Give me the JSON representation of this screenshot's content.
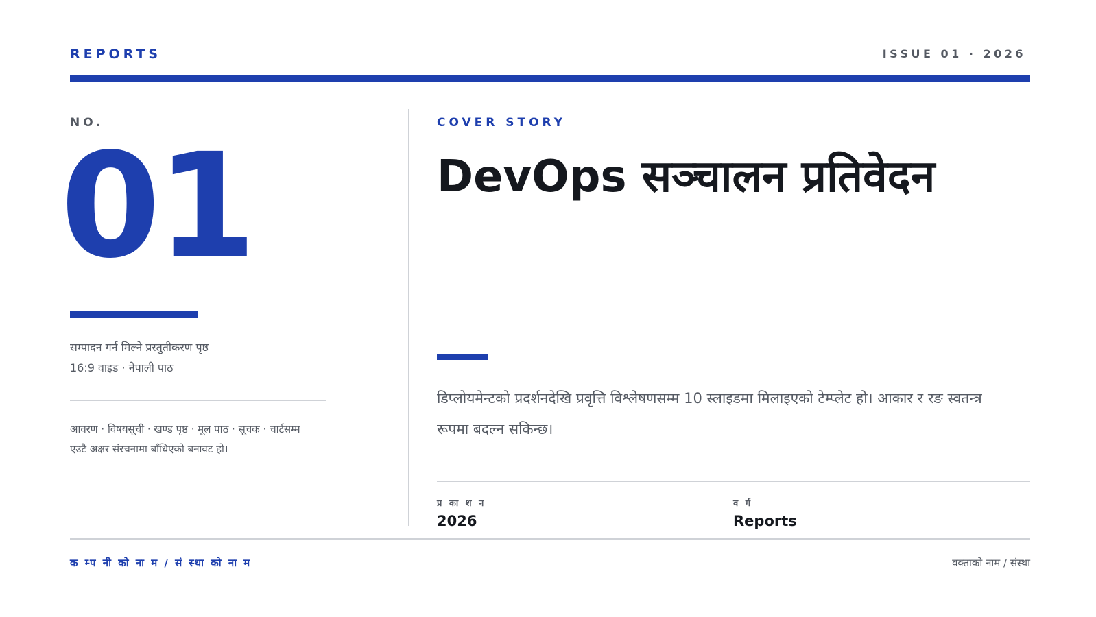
{
  "header": {
    "brand": "REPORTS",
    "issue": "ISSUE 01 · 2026"
  },
  "left": {
    "no_label": "NO.",
    "number": "01",
    "desc_line1": "सम्पादन गर्न मिल्ने प्रस्तुतीकरण पृष्ठ",
    "desc_line2": "16:9 वाइड · नेपाली पाठ",
    "contents_line1": "आवरण · विषयसूची · खण्ड पृष्ठ · मूल पाठ · सूचक · चार्टसम्म",
    "contents_line2": "एउटै अक्षर संरचनामा बाँधिएको बनावट हो।"
  },
  "right": {
    "kicker": "COVER STORY",
    "title": "DevOps सञ्चालन प्रतिवेदन",
    "summary": "डिप्लोयमेन्टको प्रदर्शनदेखि प्रवृत्ति विश्लेषणसम्म 10 स्लाइडमा मिलाइएको टेम्प्लेट हो। आकार र रङ स्वतन्त्र रूपमा बदल्न सकिन्छ।",
    "meta": {
      "publication_label": "प्र का श न",
      "publication_value": "2026",
      "category_label": "व र्ग",
      "category_value": "Reports"
    }
  },
  "footer": {
    "organization": "क म्प नी को ना म / सं स्था को ना म",
    "speaker": "वक्ताको नाम / संस्था"
  },
  "colors": {
    "accent": "#1e3fae",
    "muted_text": "#555a63",
    "divider": "#cfd2d7"
  }
}
